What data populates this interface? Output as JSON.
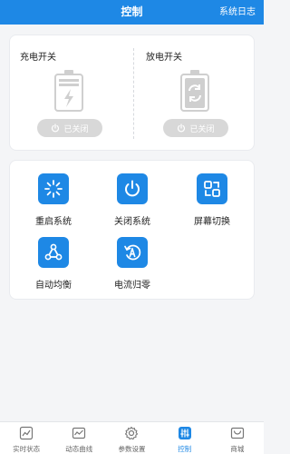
{
  "header": {
    "title": "控制",
    "log_link": "系统日志"
  },
  "switches": {
    "charge": {
      "label": "充电开关",
      "status": "已关闭"
    },
    "discharge": {
      "label": "放电开关",
      "status": "已关闭"
    }
  },
  "actions": [
    {
      "label": "重启系统",
      "icon": "restart-icon"
    },
    {
      "label": "关闭系统",
      "icon": "power-icon"
    },
    {
      "label": "屏幕切换",
      "icon": "screen-switch-icon"
    },
    {
      "label": "自动均衡",
      "icon": "balance-icon"
    },
    {
      "label": "电流归零",
      "icon": "current-zero-icon"
    }
  ],
  "tabs": [
    {
      "label": "实时状态",
      "icon": "realtime-icon"
    },
    {
      "label": "动态曲线",
      "icon": "curve-icon"
    },
    {
      "label": "参数设置",
      "icon": "settings-icon"
    },
    {
      "label": "控制",
      "icon": "control-icon",
      "active": true
    },
    {
      "label": "商城",
      "icon": "shop-icon"
    }
  ],
  "colors": {
    "primary": "#1e88e5",
    "off_button": "#d8d8d8",
    "battery_gray": "#cfcfcf"
  }
}
